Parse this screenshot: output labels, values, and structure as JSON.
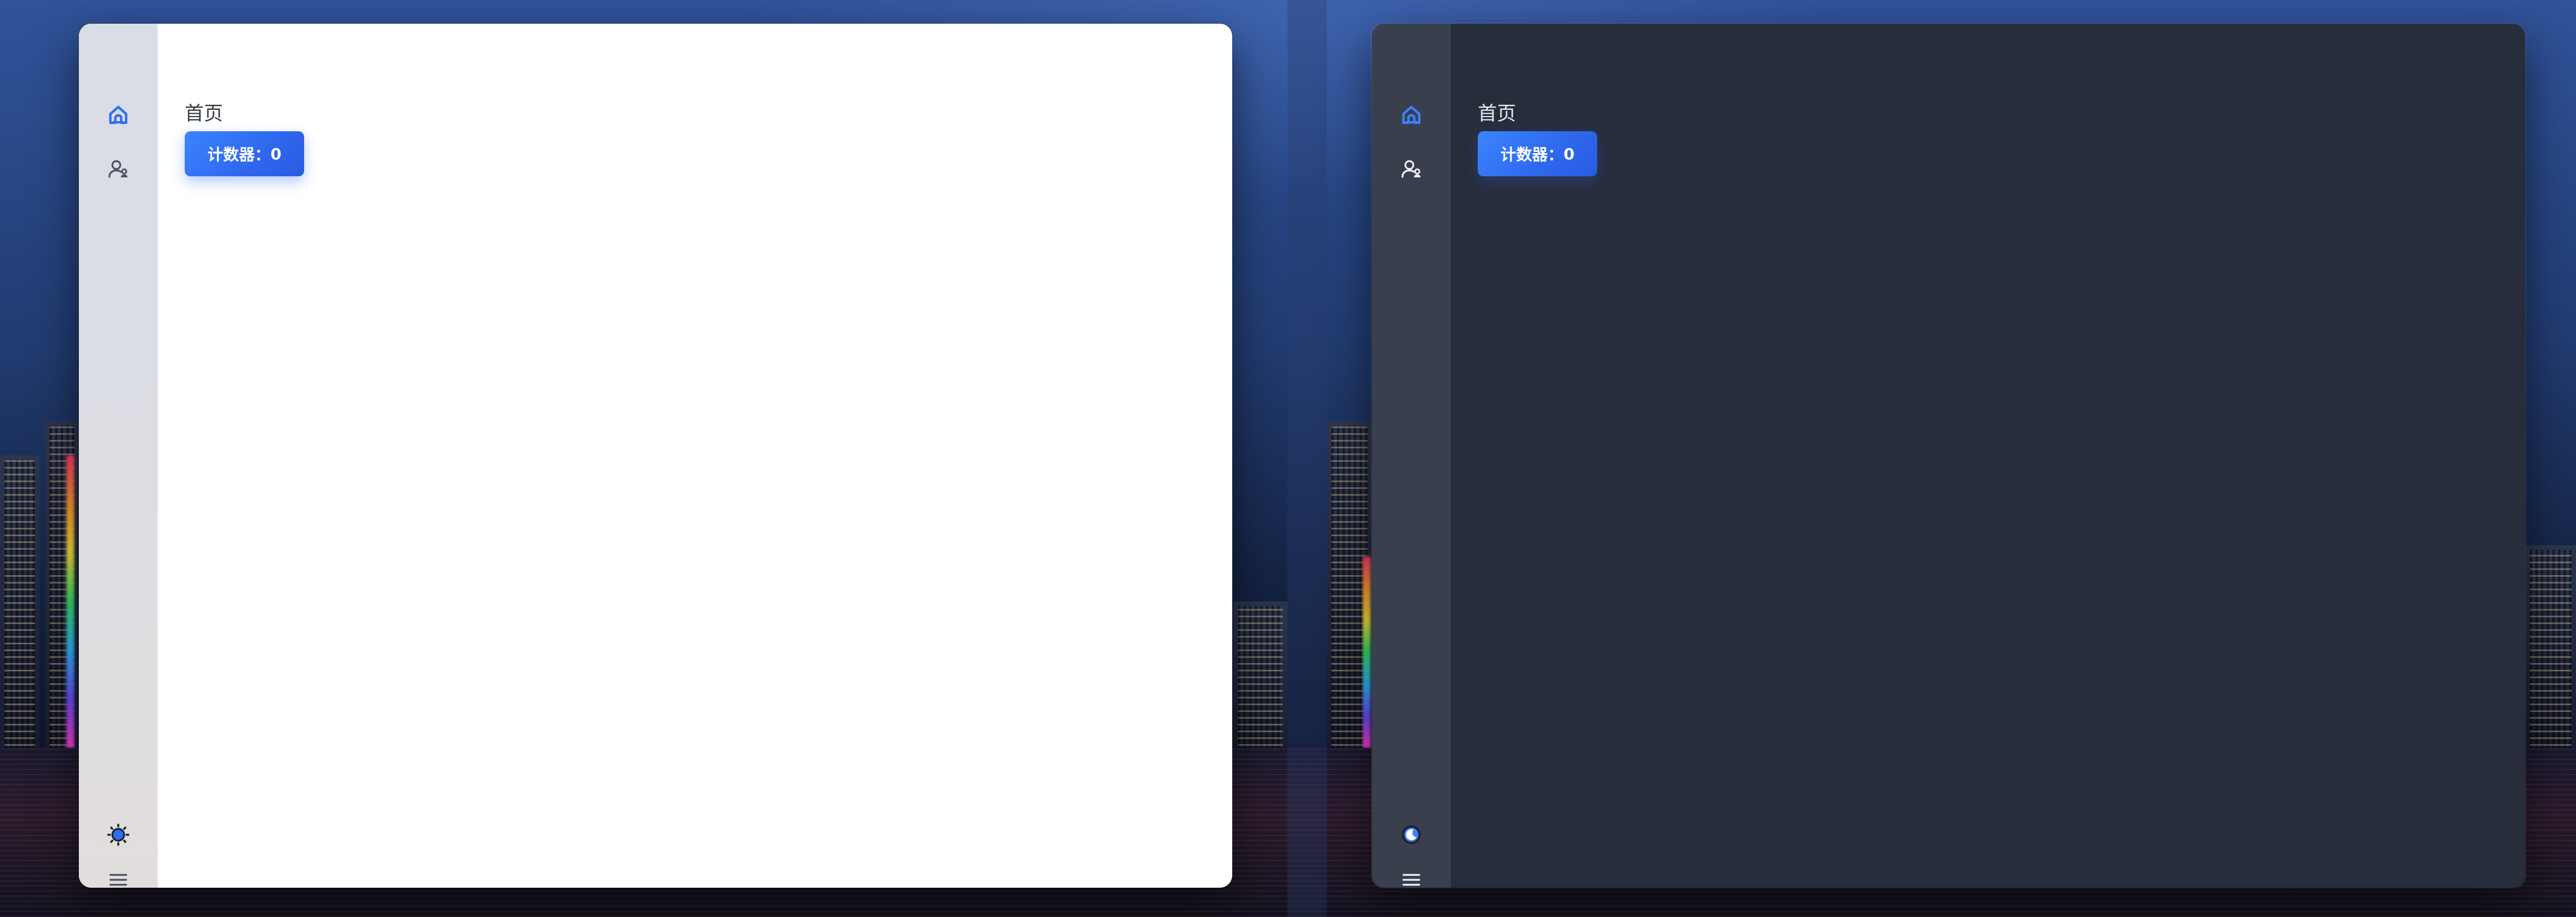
{
  "windows": [
    {
      "theme": "light",
      "title": "首页",
      "counter_label": "计数器：",
      "counter_value": "0",
      "sidebar": {
        "items": [
          {
            "icon": "home-icon",
            "active": true
          },
          {
            "icon": "user-icon",
            "active": false
          }
        ],
        "bottom": [
          {
            "icon": "sun-icon"
          },
          {
            "icon": "menu-icon"
          }
        ]
      },
      "colors": {
        "background": "#ffffff",
        "sidebar": "#dadde5",
        "accent": "#2e68ee",
        "icon": "#4b5260"
      }
    },
    {
      "theme": "dark",
      "title": "首页",
      "counter_label": "计数器：",
      "counter_value": "0",
      "sidebar": {
        "items": [
          {
            "icon": "home-icon",
            "active": true
          },
          {
            "icon": "user-icon",
            "active": false
          }
        ],
        "bottom": [
          {
            "icon": "moon-icon"
          },
          {
            "icon": "menu-icon"
          }
        ]
      },
      "colors": {
        "background": "#282d3c",
        "sidebar": "#3a3f4e",
        "accent": "#2e68ee",
        "icon": "#e8eaf0"
      }
    }
  ]
}
